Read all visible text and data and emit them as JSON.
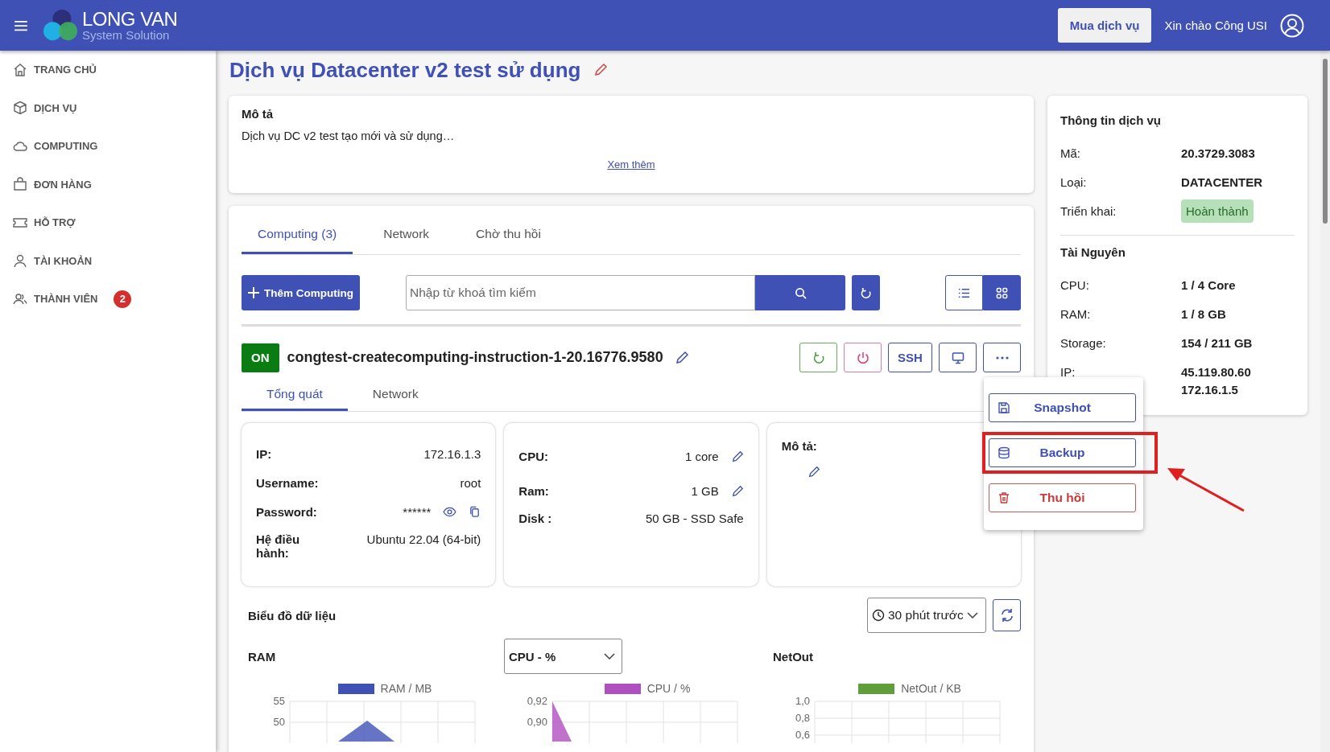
{
  "header": {
    "logo_title": "LONG VAN",
    "logo_subtitle": "System Solution",
    "buy_button": "Mua dịch vụ",
    "greeting": "Xin chào Công USI"
  },
  "sidebar": {
    "items": [
      {
        "label": "TRANG CHỦ"
      },
      {
        "label": "DỊCH VỤ"
      },
      {
        "label": "COMPUTING"
      },
      {
        "label": "ĐƠN HÀNG"
      },
      {
        "label": "HỖ TRỢ"
      },
      {
        "label": "TÀI KHOẢN"
      },
      {
        "label": "THÀNH VIÊN",
        "badge": "2"
      }
    ]
  },
  "page_title": "Dịch vụ Datacenter v2 test sử dụng",
  "description": {
    "heading": "Mô tả",
    "text": "Dịch vụ DC v2 test tạo mới và sử dụng…",
    "more_link": "Xem thêm"
  },
  "tabs": [
    {
      "label": "Computing (3)",
      "selected": true
    },
    {
      "label": "Network",
      "selected": false
    },
    {
      "label": "Chờ thu hồi",
      "selected": false
    }
  ],
  "toolbar": {
    "add_button": "Thêm Computing",
    "search": {
      "placeholder": "Nhập từ khoá tìm kiếm"
    },
    "views": [
      {
        "kind": "list",
        "selected": false
      },
      {
        "kind": "grid",
        "selected": true
      }
    ]
  },
  "computing": {
    "status": "ON",
    "name": "congtest-createcomputing-instruction-1-20.16776.9580",
    "actions": [
      {
        "kind": "restart"
      },
      {
        "kind": "power"
      },
      {
        "kind": "text",
        "label": "SSH"
      },
      {
        "kind": "console"
      },
      {
        "kind": "more"
      }
    ],
    "menu": [
      {
        "label": "Snapshot",
        "kind": "save",
        "highlighted": false
      },
      {
        "label": "Backup",
        "kind": "database",
        "highlighted": true
      },
      {
        "label": "Thu hồi",
        "kind": "delete",
        "highlighted": false
      }
    ],
    "subtabs": [
      {
        "label": "Tổng quát",
        "selected": true
      },
      {
        "label": "Network",
        "selected": false
      }
    ],
    "access": [
      {
        "label": "IP:",
        "value": "172.16.1.3"
      },
      {
        "label": "Username:",
        "value": "root"
      },
      {
        "label": "Password:",
        "value": "******",
        "secret": true
      },
      {
        "label": "Hệ điều hành:",
        "value": "Ubuntu 22.04 (64-bit)"
      }
    ],
    "specs": [
      {
        "label": "CPU:",
        "value": "1 core",
        "editable": true
      },
      {
        "label": "Ram:",
        "value": "1 GB",
        "editable": true
      },
      {
        "label": "Disk :",
        "value": "50 GB - SSD Safe",
        "editable": false
      }
    ],
    "note_label": "Mô tả:"
  },
  "charts_section": {
    "title": "Biểu đồ dữ liệu",
    "range": "30 phút trước",
    "charts": [
      {
        "heading": "RAM",
        "legend": "RAM / MB",
        "color": "#3f51b5",
        "y_tick_labels": [
          "55",
          "50"
        ]
      },
      {
        "select": "CPU - %",
        "legend": "CPU / %",
        "color": "#b04fbf",
        "y_tick_labels": [
          "0,92",
          "0,90"
        ]
      },
      {
        "heading": "NetOut",
        "legend": "NetOut / KB",
        "color": "#5f9e3a",
        "y_tick_labels": [
          "1,0",
          "0,8",
          "0,6"
        ]
      }
    ]
  },
  "service_info": {
    "heading": "Thông tin dịch vụ",
    "rows": [
      {
        "label": "Mã:",
        "value": "20.3729.3083"
      },
      {
        "label": "Loại:",
        "value": "DATACENTER"
      },
      {
        "label": "Triển khai:",
        "value": "Hoàn thành",
        "kind": "badge"
      }
    ],
    "resources_heading": "Tài Nguyên",
    "resources": [
      {
        "label": "CPU:",
        "value": "1 / 4 Core"
      },
      {
        "label": "RAM:",
        "value": "1 / 8 GB"
      },
      {
        "label": "Storage:",
        "value": "154 / 211 GB"
      },
      {
        "label": "IP:",
        "value": "45.119.80.60"
      },
      {
        "value": "172.16.1.5"
      }
    ]
  }
}
